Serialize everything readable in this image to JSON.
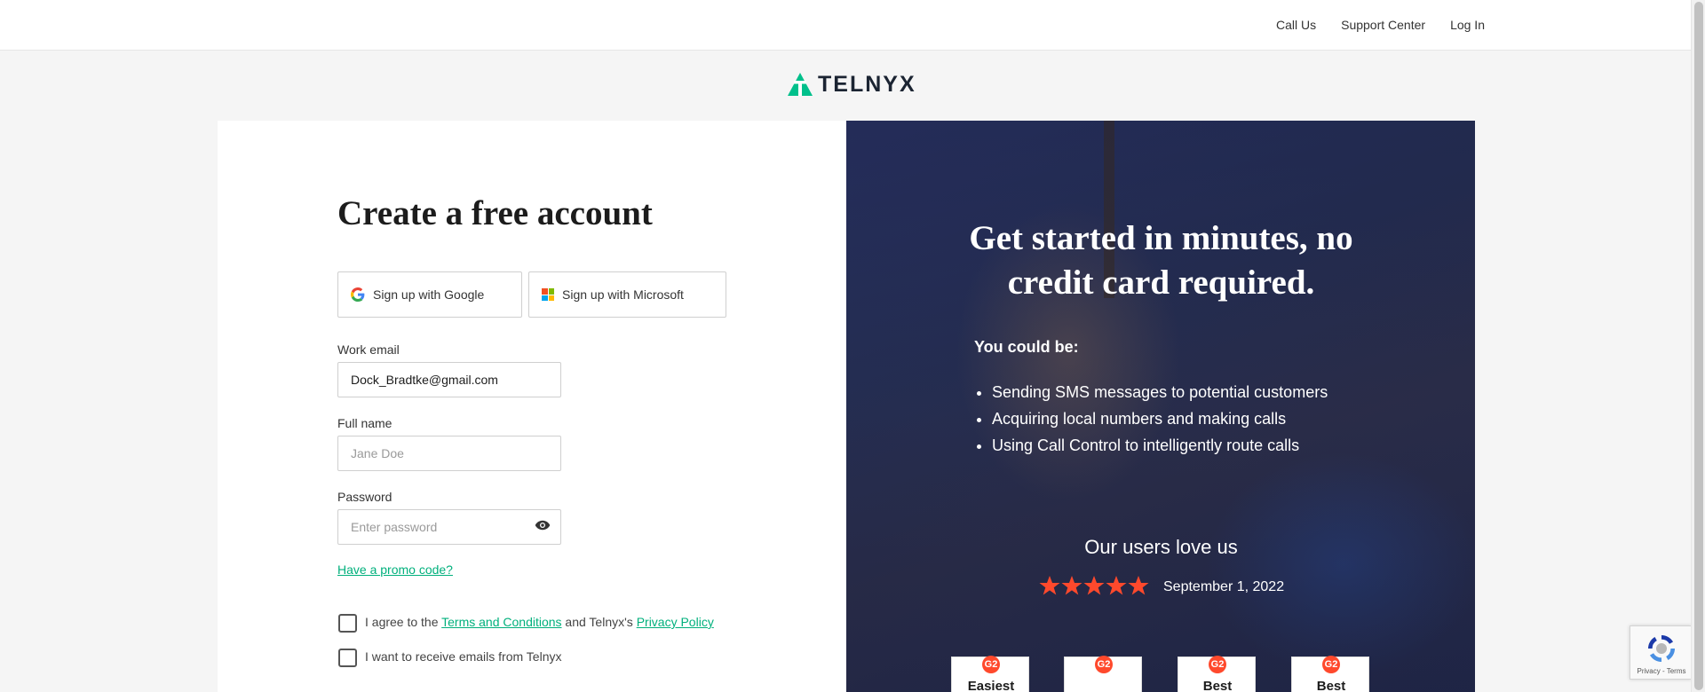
{
  "nav": {
    "links": [
      "Call Us",
      "Support Center",
      "Log In"
    ]
  },
  "brand": {
    "name": "TELNYX",
    "accent": "#00c08b"
  },
  "form": {
    "title": "Create a free account",
    "google_label": "Sign up with Google",
    "microsoft_label": "Sign up with Microsoft",
    "email_label": "Work email",
    "email_value": "Dock_Bradtke@gmail.com",
    "name_label": "Full name",
    "name_placeholder": "Jane Doe",
    "password_label": "Password",
    "password_placeholder": "Enter password",
    "promo_link": "Have a promo code?",
    "terms": {
      "prefix": "I agree to the ",
      "terms_link": "Terms and Conditions",
      "middle": " and Telnyx's ",
      "privacy_link": "Privacy Policy",
      "checked": false
    },
    "emails_optin": {
      "label": "I want to receive emails from Telnyx",
      "checked": false
    }
  },
  "promo_panel": {
    "headline": "Get started in minutes, no credit card required.",
    "subhead": "You could be:",
    "bullets": [
      "Sending SMS messages to potential customers",
      "Acquiring local numbers and making calls",
      "Using Call Control to intelligently route calls"
    ],
    "love_title": "Our users love us",
    "rating": 5,
    "rating_date": "September 1, 2022",
    "badges": [
      "Easiest",
      "",
      "Best",
      "Best"
    ],
    "badge_logo": "G2",
    "star_color": "#ff492c"
  },
  "recaptcha": {
    "text": "Privacy - Terms"
  }
}
